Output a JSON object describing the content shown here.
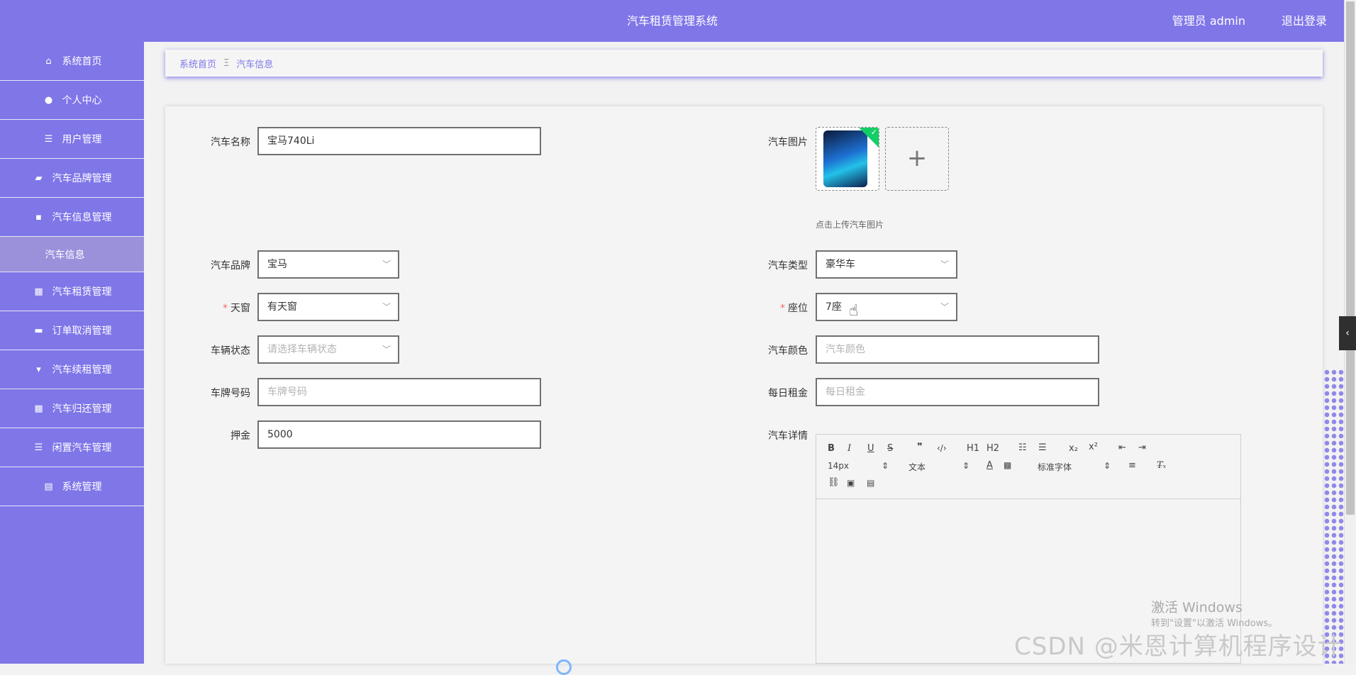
{
  "header": {
    "title": "汽车租赁管理系统",
    "user": "管理员 admin",
    "logout": "退出登录"
  },
  "sidebar": {
    "items": [
      {
        "label": "系统首页",
        "icon": "home-icon"
      },
      {
        "label": "个人中心",
        "icon": "user-icon"
      },
      {
        "label": "用户管理",
        "icon": "list-icon"
      },
      {
        "label": "汽车品牌管理",
        "icon": "wallet-icon"
      },
      {
        "label": "汽车信息管理",
        "icon": "chat-icon"
      },
      {
        "label": "汽车信息",
        "sub": true
      },
      {
        "label": "汽车租赁管理",
        "icon": "grid-icon"
      },
      {
        "label": "订单取消管理",
        "icon": "ticket-icon"
      },
      {
        "label": "汽车续租管理",
        "icon": "marker-icon"
      },
      {
        "label": "汽车归还管理",
        "icon": "grid-icon"
      },
      {
        "label": "闲置汽车管理",
        "icon": "list-icon"
      },
      {
        "label": "系统管理",
        "icon": "briefcase-icon"
      }
    ]
  },
  "breadcrumb": {
    "home": "系统首页",
    "separator": "Ξ",
    "current": "汽车信息"
  },
  "form": {
    "car_name": {
      "label": "汽车名称",
      "value": "宝马740Li"
    },
    "car_image": {
      "label": "汽车图片",
      "hint": "点击上传汽车图片"
    },
    "brand": {
      "label": "汽车品牌",
      "value": "宝马"
    },
    "type": {
      "label": "汽车类型",
      "value": "豪华车"
    },
    "sunroof": {
      "label": "天窗",
      "value": "有天窗",
      "required_mark": "*"
    },
    "seats": {
      "label": "座位",
      "value": "7座",
      "required_mark": "*"
    },
    "status": {
      "label": "车辆状态",
      "placeholder": "请选择车辆状态"
    },
    "color": {
      "label": "汽车颜色",
      "placeholder": "汽车颜色"
    },
    "plate": {
      "label": "车牌号码",
      "placeholder": "车牌号码"
    },
    "daily_rent": {
      "label": "每日租金",
      "placeholder": "每日租金"
    },
    "deposit": {
      "label": "押金",
      "value": "5000"
    },
    "details": {
      "label": "汽车详情"
    }
  },
  "editor": {
    "font_size": "14px",
    "block": "文本",
    "font_family": "标准字体",
    "h1": "H1",
    "h2": "H2"
  },
  "overlay": {
    "win_title": "激活 Windows",
    "win_sub": "转到\"设置\"以激活 Windows。",
    "watermark": "CSDN @米恩计算机程序设计"
  }
}
